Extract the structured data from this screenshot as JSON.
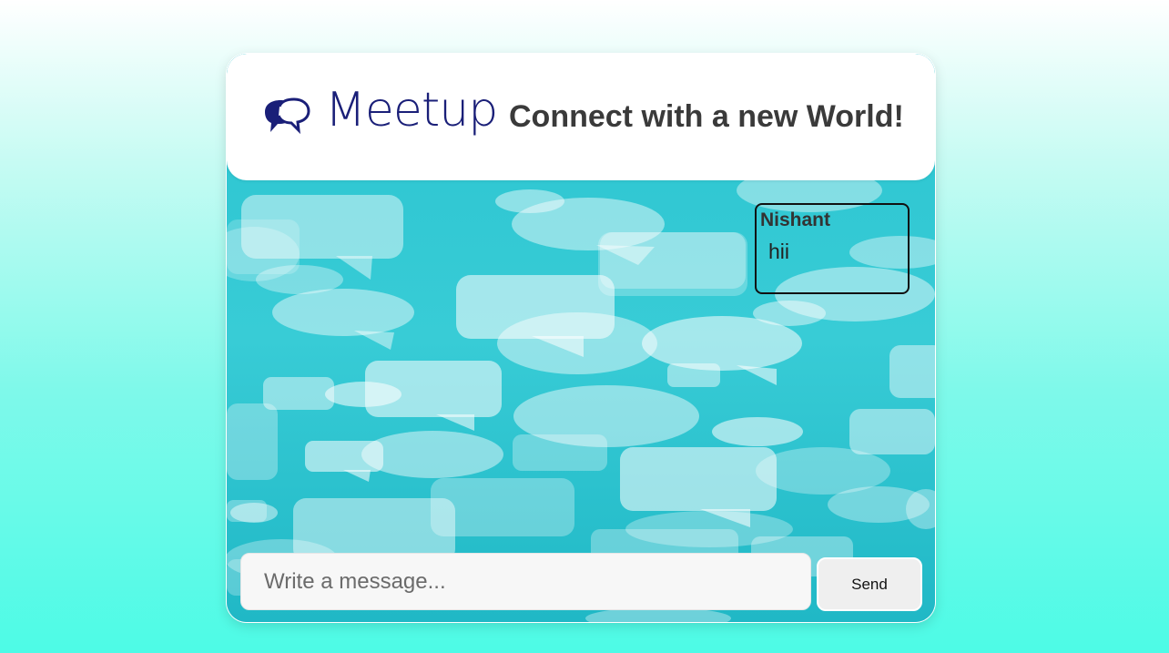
{
  "header": {
    "logo_text": "Meetup",
    "logo_icon": "speech-bubbles-icon",
    "tagline": "Connect with a new World!"
  },
  "messages": [
    {
      "sender": "Nishant",
      "text": "hii"
    }
  ],
  "composer": {
    "placeholder": "Write a message...",
    "value": "",
    "send_label": "Send"
  },
  "colors": {
    "logo": "#1a1f78",
    "chat_background": "#2ec7d2",
    "page_gradient_bottom": "#4dfbe6"
  }
}
